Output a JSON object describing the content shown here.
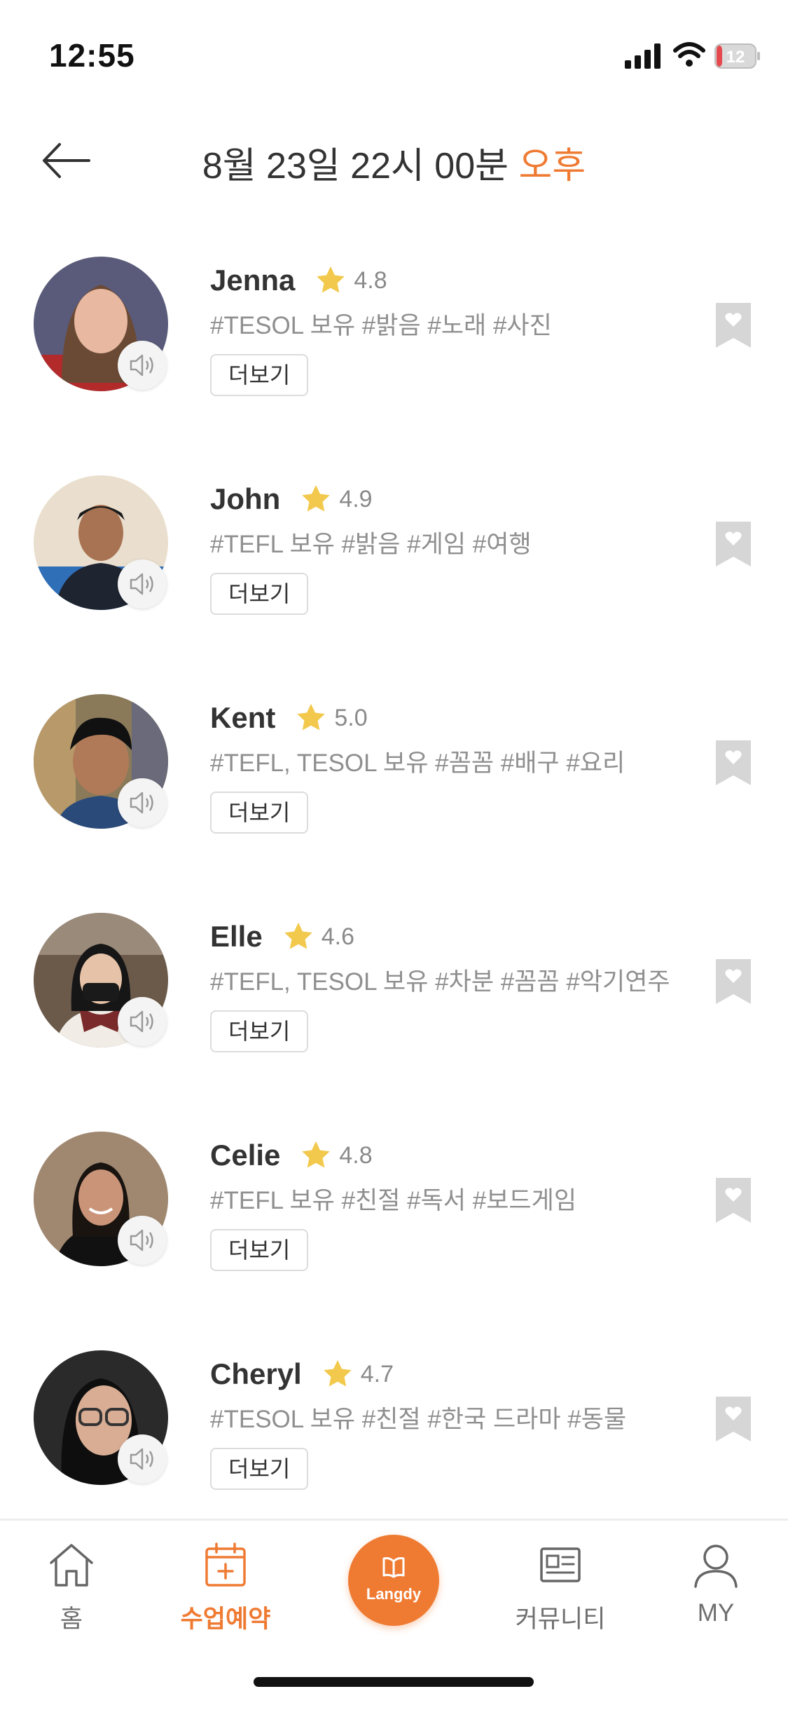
{
  "status": {
    "time": "12:55",
    "battery": "12"
  },
  "header": {
    "date_text": "8월 23일 22시 00분",
    "ampm": "오후"
  },
  "colors": {
    "accent": "#ef7b33",
    "star": "#f2c94c"
  },
  "tutors": [
    {
      "name": "Jenna",
      "rating": "4.8",
      "tags": "#TESOL 보유 #밝음 #노래 #사진",
      "more": "더보기"
    },
    {
      "name": "John",
      "rating": "4.9",
      "tags": "#TEFL 보유 #밝음 #게임 #여행",
      "more": "더보기"
    },
    {
      "name": "Kent",
      "rating": "5.0",
      "tags": "#TEFL, TESOL 보유 #꼼꼼 #배구 #요리",
      "more": "더보기"
    },
    {
      "name": "Elle",
      "rating": "4.6",
      "tags": "#TEFL, TESOL 보유 #차분 #꼼꼼 #악기연주",
      "more": "더보기"
    },
    {
      "name": "Celie",
      "rating": "4.8",
      "tags": "#TEFL 보유 #친절 #독서 #보드게임",
      "more": "더보기"
    },
    {
      "name": "Cheryl",
      "rating": "4.7",
      "tags": "#TESOL 보유 #친절 #한국 드라마 #동물",
      "more": "더보기"
    }
  ],
  "nav": {
    "home": "홈",
    "booking": "수업예약",
    "center": "Langdy",
    "community": "커뮤니티",
    "my": "MY"
  }
}
